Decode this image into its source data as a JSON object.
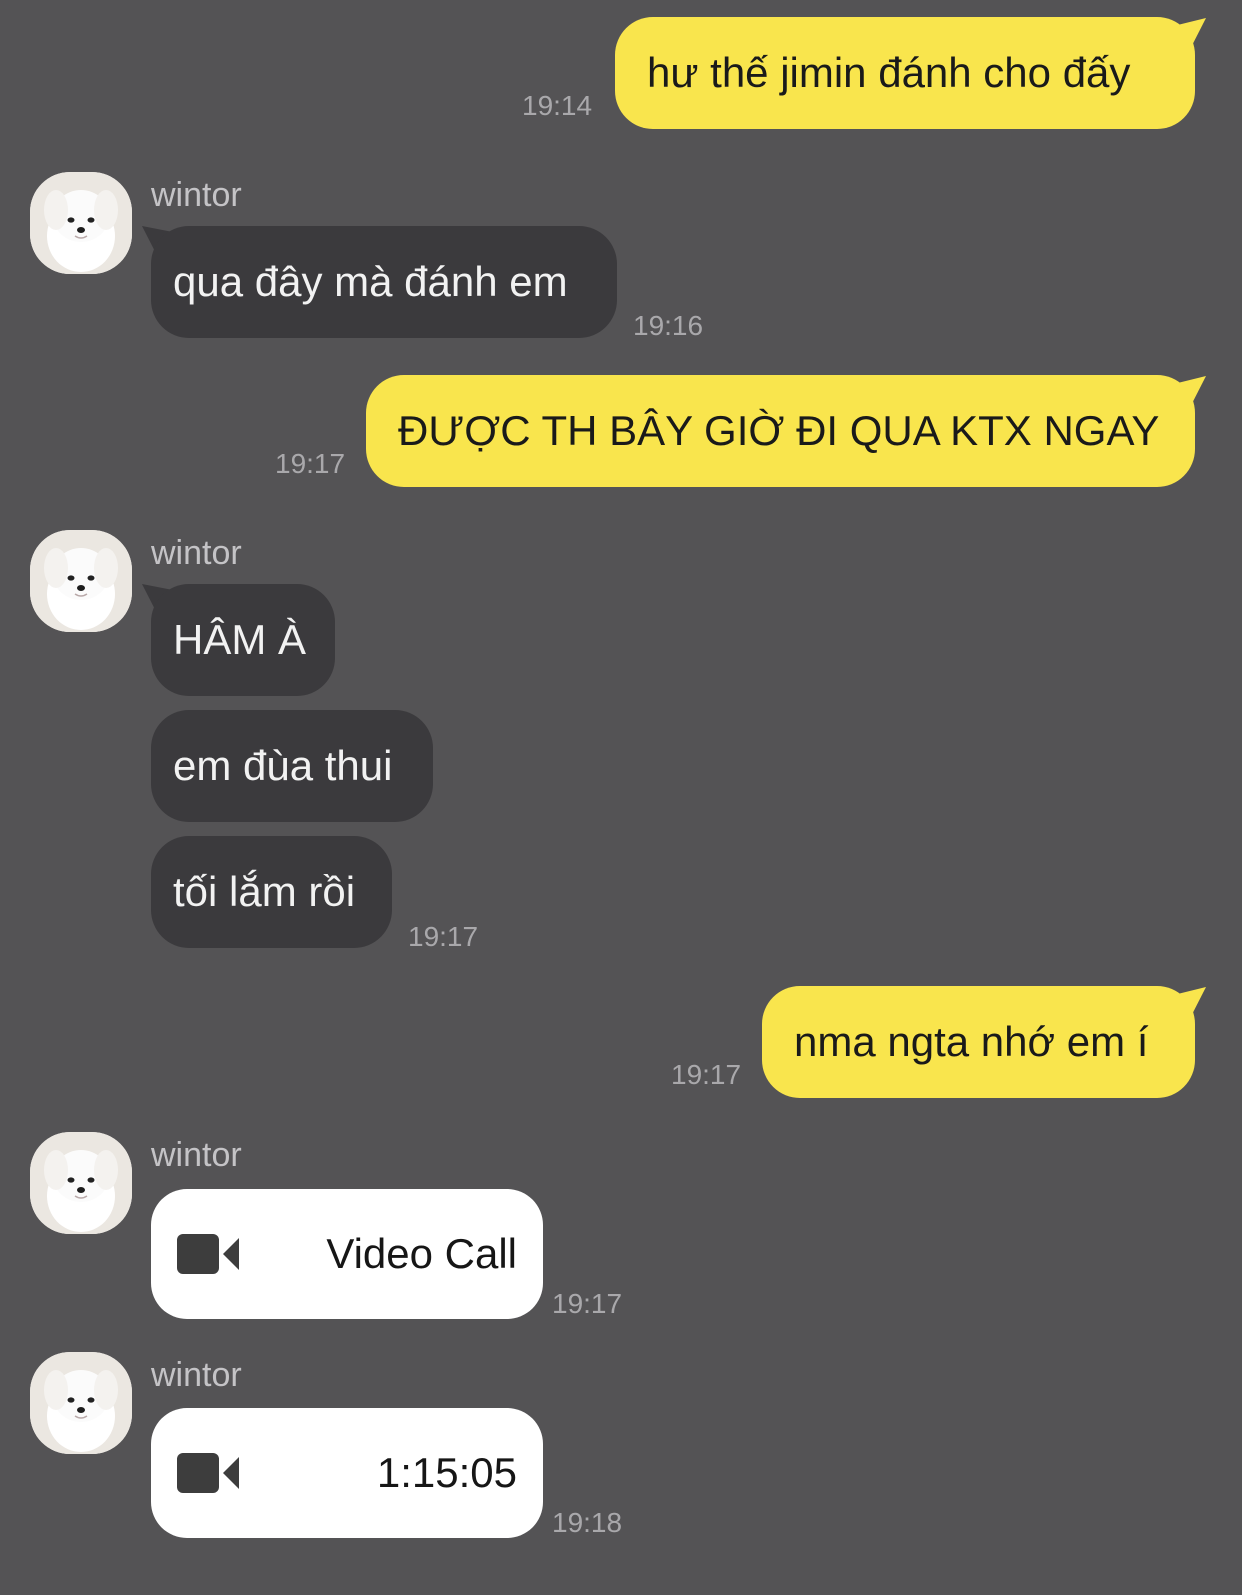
{
  "messages": [
    {
      "type": "sent",
      "text": "hư thế jimin đánh cho đấy",
      "time": "19:14"
    },
    {
      "type": "received",
      "sender": "wintor",
      "text": "qua đây mà đánh em",
      "time": "19:16"
    },
    {
      "type": "sent",
      "text": "ĐƯỢC TH BÂY GIỜ ĐI QUA KTX NGAY",
      "time": "19:17"
    },
    {
      "type": "received",
      "sender": "wintor",
      "text": "HÂM À"
    },
    {
      "type": "received",
      "text": "em đùa thui"
    },
    {
      "type": "received",
      "text": "tối lắm rồi",
      "time": "19:17"
    },
    {
      "type": "sent",
      "text": "nma ngta nhớ em í",
      "time": "19:17"
    },
    {
      "type": "call",
      "sender": "wintor",
      "text": "Video Call",
      "time": "19:17",
      "icon": "video-camera-icon"
    },
    {
      "type": "call",
      "sender": "wintor",
      "text": "1:15:05",
      "time": "19:18",
      "icon": "video-camera-icon"
    }
  ],
  "colors": {
    "background": "#545355",
    "sent_bubble": "#f9e54d",
    "received_bubble": "#3b3a3d",
    "call_bubble": "#ffffff"
  }
}
